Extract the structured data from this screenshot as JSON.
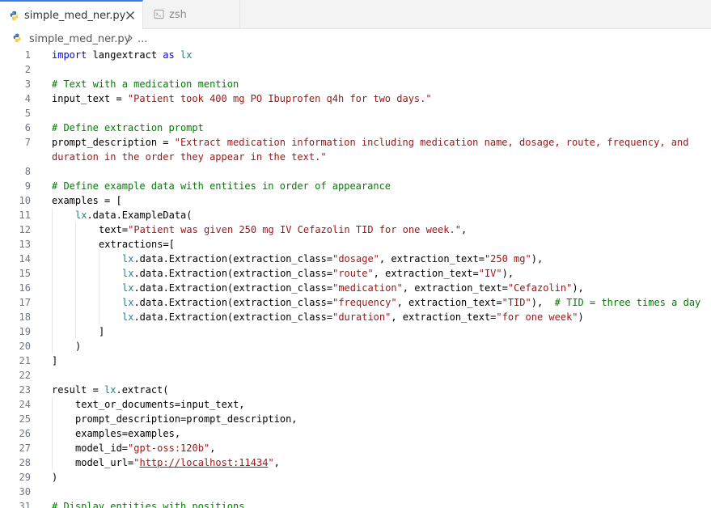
{
  "tabs": [
    {
      "label": "simple_med_ner.py",
      "icon": "python-file-icon",
      "active": true
    },
    {
      "label": "zsh",
      "icon": "terminal-icon",
      "active": false
    }
  ],
  "breadcrumb": {
    "file": "simple_med_ner.py",
    "more": "..."
  },
  "colors": {
    "keyword": "#0000ff",
    "string": "#a31515",
    "comment": "#008000",
    "class": "#267f99",
    "accent": "#3b7ee8"
  },
  "lines": [
    {
      "n": "1",
      "indent": 0,
      "t": [
        [
          "kw",
          "import"
        ],
        [
          "",
          "langextract"
        ],
        [
          "kw",
          "as"
        ],
        [
          "cls",
          "lx"
        ]
      ]
    },
    {
      "n": "2",
      "indent": 0,
      "t": []
    },
    {
      "n": "3",
      "indent": 0,
      "t": [
        [
          "cm",
          "# Text with a medication mention"
        ]
      ]
    },
    {
      "n": "4",
      "indent": 0,
      "t": [
        [
          "",
          "input_text = "
        ],
        [
          "str",
          "\"Patient took 400 mg PO Ibuprofen q4h for two days.\""
        ]
      ]
    },
    {
      "n": "5",
      "indent": 0,
      "t": []
    },
    {
      "n": "6",
      "indent": 0,
      "t": [
        [
          "cm",
          "# Define extraction prompt"
        ]
      ]
    },
    {
      "n": "7",
      "indent": 0,
      "t": [
        [
          "",
          "prompt_description = "
        ],
        [
          "str",
          "\"Extract medication information including medication name, dosage, route, frequency, and"
        ]
      ]
    },
    {
      "n": "",
      "indent": 0,
      "t": [
        [
          "str",
          "duration in the order they appear in the text.\""
        ]
      ]
    },
    {
      "n": "8",
      "indent": 0,
      "t": []
    },
    {
      "n": "9",
      "indent": 0,
      "t": [
        [
          "cm",
          "# Define example data with entities in order of appearance"
        ]
      ]
    },
    {
      "n": "10",
      "indent": 0,
      "t": [
        [
          "",
          "examples = ["
        ]
      ]
    },
    {
      "n": "11",
      "indent": 1,
      "t": [
        [
          "cls",
          "lx"
        ],
        [
          "",
          ".data.ExampleData("
        ]
      ]
    },
    {
      "n": "12",
      "indent": 2,
      "t": [
        [
          "",
          "text="
        ],
        [
          "str",
          "\"Patient was given 250 mg IV Cefazolin TID for one week.\""
        ],
        [
          "",
          ","
        ]
      ]
    },
    {
      "n": "13",
      "indent": 2,
      "t": [
        [
          "",
          "extractions=["
        ]
      ]
    },
    {
      "n": "14",
      "indent": 3,
      "t": [
        [
          "cls",
          "lx"
        ],
        [
          "",
          ".data.Extraction(extraction_class="
        ],
        [
          "str",
          "\"dosage\""
        ],
        [
          "",
          ", extraction_text="
        ],
        [
          "str",
          "\"250 mg\""
        ],
        [
          "",
          "),"
        ]
      ]
    },
    {
      "n": "15",
      "indent": 3,
      "t": [
        [
          "cls",
          "lx"
        ],
        [
          "",
          ".data.Extraction(extraction_class="
        ],
        [
          "str",
          "\"route\""
        ],
        [
          "",
          ", extraction_text="
        ],
        [
          "str",
          "\"IV\""
        ],
        [
          "",
          "),"
        ]
      ]
    },
    {
      "n": "16",
      "indent": 3,
      "t": [
        [
          "cls",
          "lx"
        ],
        [
          "",
          ".data.Extraction(extraction_class="
        ],
        [
          "str",
          "\"medication\""
        ],
        [
          "",
          ", extraction_text="
        ],
        [
          "str",
          "\"Cefazolin\""
        ],
        [
          "",
          "),"
        ]
      ]
    },
    {
      "n": "17",
      "indent": 3,
      "t": [
        [
          "cls",
          "lx"
        ],
        [
          "",
          ".data.Extraction(extraction_class="
        ],
        [
          "str",
          "\"frequency\""
        ],
        [
          "",
          ", extraction_text="
        ],
        [
          "str",
          "\"TID\""
        ],
        [
          "",
          "),  "
        ],
        [
          "cm",
          "# TID = three times a day"
        ]
      ]
    },
    {
      "n": "18",
      "indent": 3,
      "t": [
        [
          "cls",
          "lx"
        ],
        [
          "",
          ".data.Extraction(extraction_class="
        ],
        [
          "str",
          "\"duration\""
        ],
        [
          "",
          ", extraction_text="
        ],
        [
          "str",
          "\"for one week\""
        ],
        [
          "",
          ")"
        ]
      ]
    },
    {
      "n": "19",
      "indent": 2,
      "t": [
        [
          "",
          "]"
        ]
      ]
    },
    {
      "n": "20",
      "indent": 1,
      "t": [
        [
          "",
          ")"
        ]
      ]
    },
    {
      "n": "21",
      "indent": 0,
      "t": [
        [
          "",
          "]"
        ]
      ]
    },
    {
      "n": "22",
      "indent": 0,
      "t": []
    },
    {
      "n": "23",
      "indent": 0,
      "t": [
        [
          "",
          "result = "
        ],
        [
          "cls",
          "lx"
        ],
        [
          "",
          ".extract("
        ]
      ]
    },
    {
      "n": "24",
      "indent": 1,
      "t": [
        [
          "",
          "text_or_documents=input_text,"
        ]
      ]
    },
    {
      "n": "25",
      "indent": 1,
      "t": [
        [
          "",
          "prompt_description=prompt_description,"
        ]
      ]
    },
    {
      "n": "26",
      "indent": 1,
      "t": [
        [
          "",
          "examples=examples,"
        ]
      ]
    },
    {
      "n": "27",
      "indent": 1,
      "t": [
        [
          "",
          "model_id="
        ],
        [
          "str",
          "\"gpt-oss:120b\""
        ],
        [
          "",
          ","
        ]
      ]
    },
    {
      "n": "28",
      "indent": 1,
      "t": [
        [
          "",
          "model_url="
        ],
        [
          "str",
          "\""
        ],
        [
          "url",
          "http://localhost:11434"
        ],
        [
          "str",
          "\""
        ],
        [
          "",
          ","
        ]
      ]
    },
    {
      "n": "29",
      "indent": 0,
      "t": [
        [
          "",
          ")"
        ]
      ]
    },
    {
      "n": "30",
      "indent": 0,
      "t": []
    },
    {
      "n": "31",
      "indent": 0,
      "t": [
        [
          "cm",
          "# Display entities with positions"
        ]
      ]
    }
  ]
}
